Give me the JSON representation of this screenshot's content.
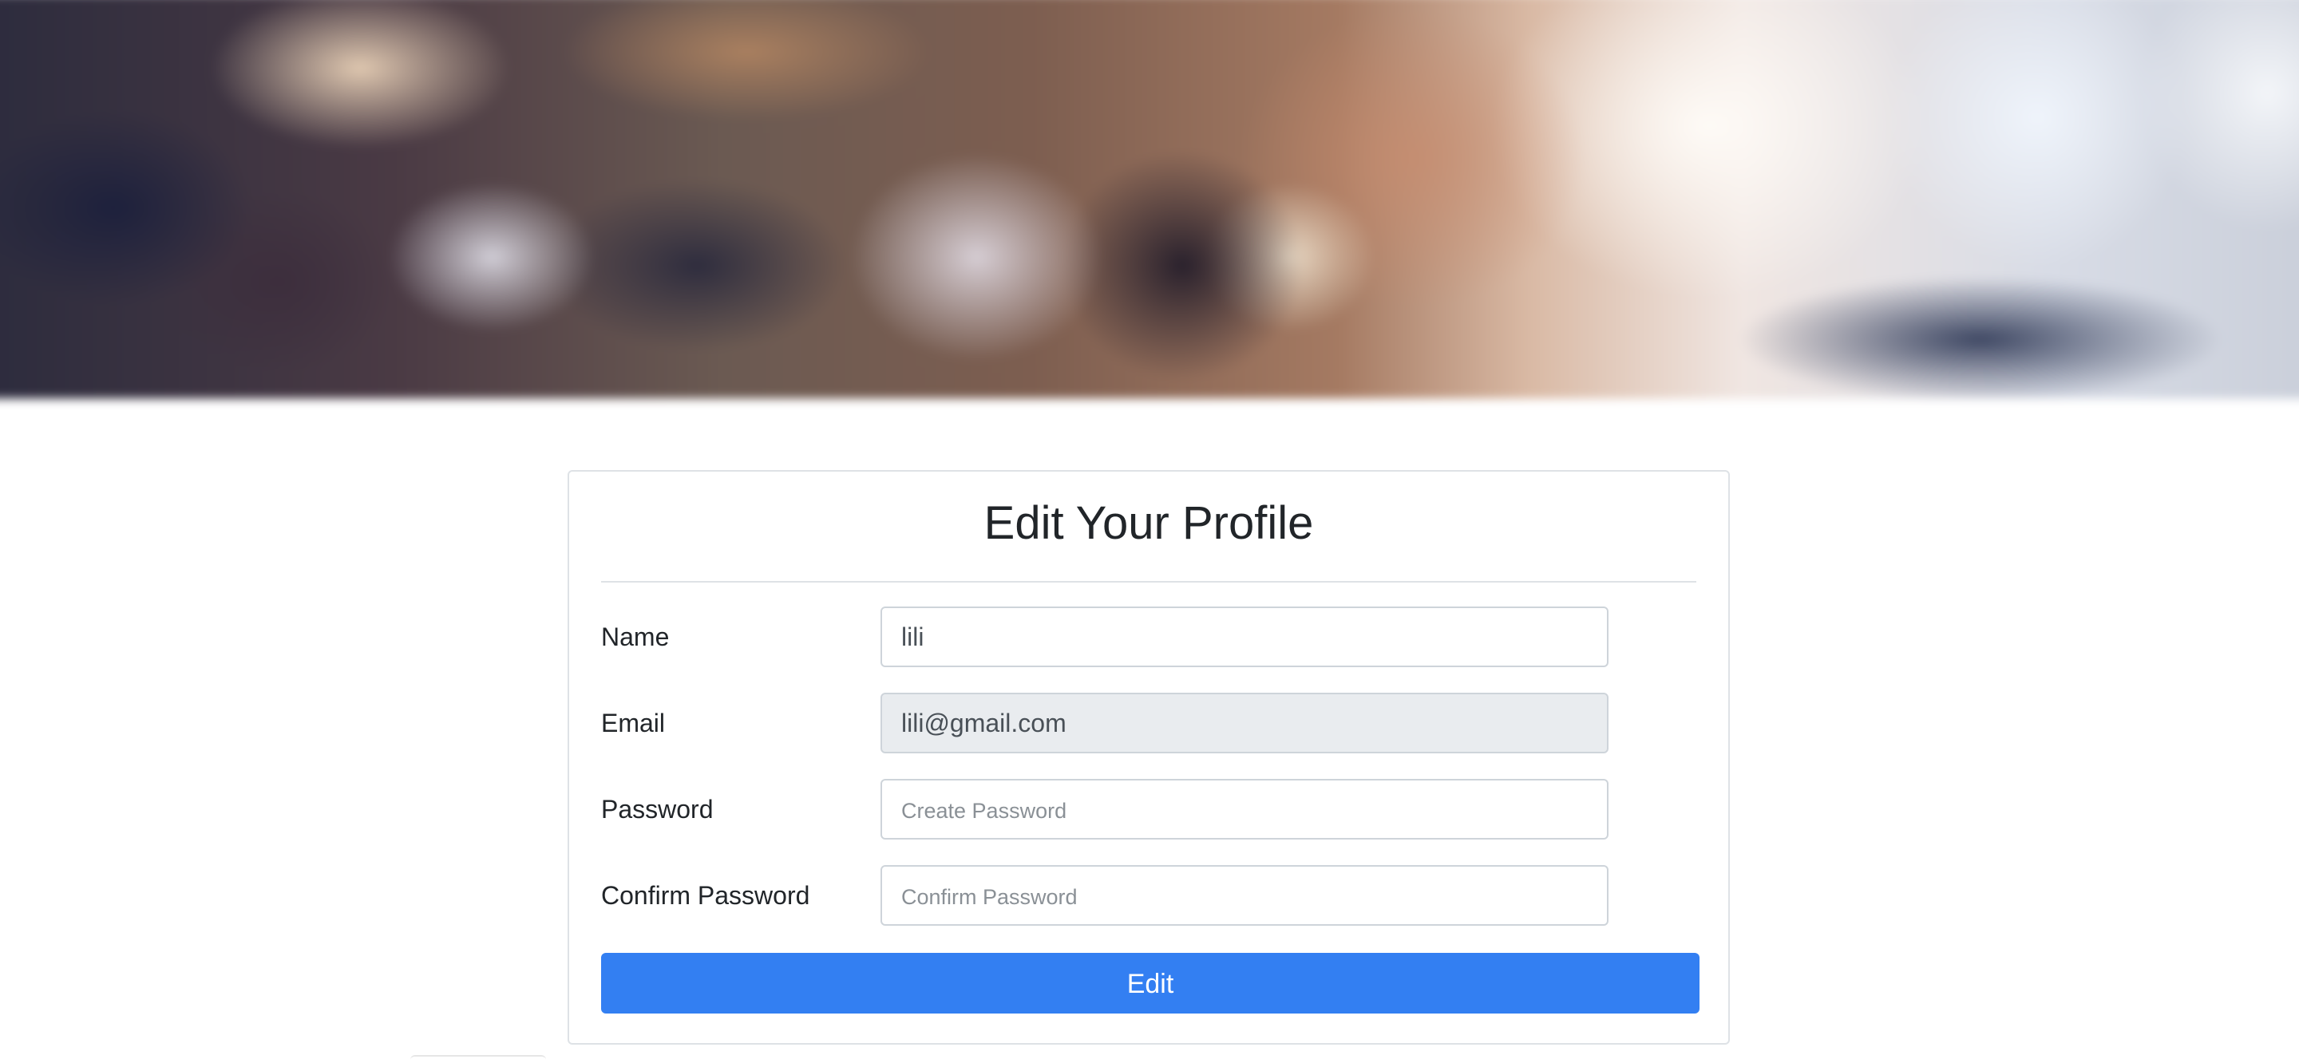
{
  "hero": {
    "alt": "blurred cafe interior background"
  },
  "form": {
    "title": "Edit Your Profile",
    "fields": [
      {
        "label": "Name",
        "value": "lili",
        "placeholder": "",
        "readonly": false
      },
      {
        "label": "Email",
        "value": "lili@gmail.com",
        "placeholder": "",
        "readonly": true
      },
      {
        "label": "Password",
        "value": "",
        "placeholder": "Create Password",
        "readonly": false
      },
      {
        "label": "Confirm Password",
        "value": "",
        "placeholder": "Confirm Password",
        "readonly": false
      }
    ],
    "submit_label": "Edit"
  },
  "colors": {
    "primary_button": "#337ff2",
    "readonly_field": "#e9ecef",
    "border": "#dee2e6"
  }
}
